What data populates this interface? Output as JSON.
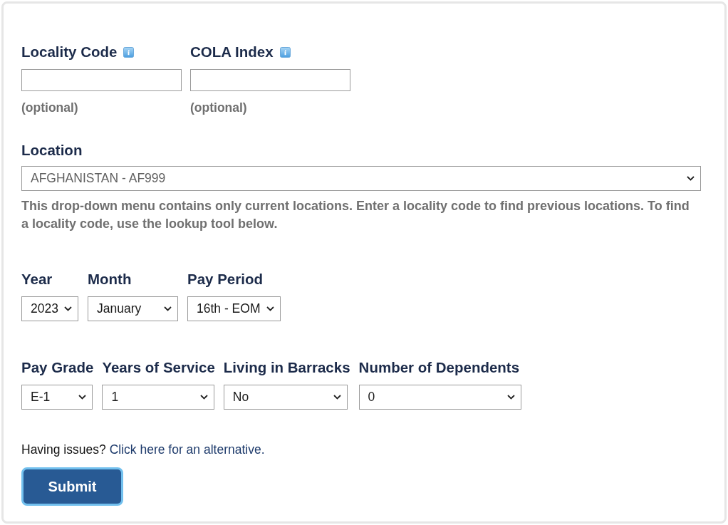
{
  "code_fields": [
    {
      "label": "Locality Code",
      "hint": "(optional)"
    },
    {
      "label": "COLA Index",
      "hint": "(optional)"
    }
  ],
  "location": {
    "label": "Location",
    "value": "AFGHANISTAN - AF999",
    "help": "This drop-down menu contains only current locations. Enter a locality code to find previous locations. To find a locality code, use the lookup tool below."
  },
  "date_fields": [
    {
      "label": "Year",
      "value": "2023"
    },
    {
      "label": "Month",
      "value": "January"
    },
    {
      "label": "Pay Period",
      "value": "16th - EOM"
    }
  ],
  "service_fields": [
    {
      "label": "Pay Grade",
      "value": "E-1"
    },
    {
      "label": "Years of Service",
      "value": "1"
    },
    {
      "label": "Living in Barracks",
      "value": "No"
    },
    {
      "label": "Number of Dependents",
      "value": "0"
    }
  ],
  "alternative": {
    "text": "Having issues?",
    "link": "Click here for an alternative."
  },
  "submit": {
    "label": "Submit"
  }
}
